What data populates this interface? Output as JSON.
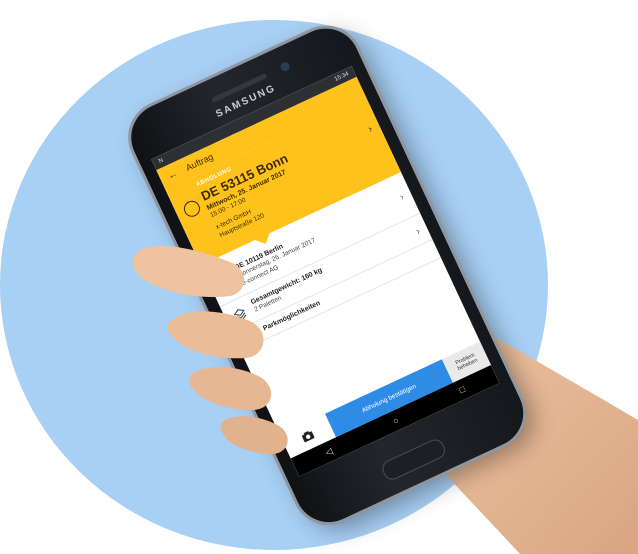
{
  "phone": {
    "brand": "SAMSUNG",
    "time": "15:34"
  },
  "app": {
    "title": "Auftrag",
    "pickup": {
      "tag": "ABHOLUNG",
      "city": "DE 53115 Bonn",
      "date": "Mittwoch, 25. Januar 2017",
      "time": "15:00 - 17:00",
      "company": "x-tech GmbH",
      "street": "Hauptstraße 120"
    },
    "delivery": {
      "city": "DE 10119 Berlin",
      "date": "Donnerstag, 26. Januar 2017",
      "company": "e-connect AG"
    },
    "weight": {
      "title": "Gesamtgewicht: 160 kg",
      "detail": "2 Paletten"
    },
    "parking": {
      "title": "Parkmöglichkeiten"
    },
    "actions": {
      "confirm": "Abholung bestätigen",
      "problem": "Problem beheben"
    }
  },
  "colors": {
    "background_circle": "#a8cff4",
    "accent": "#ffc21a",
    "button": "#2e8be6"
  },
  "icons": [
    "back-arrow-icon",
    "pickup-pin-icon",
    "flag-icon",
    "stack-icon",
    "parking-icon",
    "camera-icon",
    "chevron-right-icon"
  ]
}
